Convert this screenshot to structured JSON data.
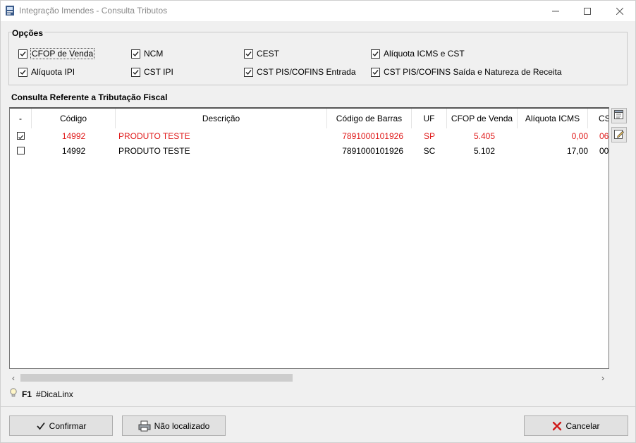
{
  "window": {
    "title": "Integração Imendes - Consulta Tributos"
  },
  "options": {
    "title": "Opções",
    "checkboxes": [
      {
        "label": "CFOP de Venda",
        "checked": true
      },
      {
        "label": "NCM",
        "checked": true
      },
      {
        "label": "CEST",
        "checked": true
      },
      {
        "label": "Alíquota ICMS e CST",
        "checked": true
      },
      {
        "label": "Alíquota IPI",
        "checked": true
      },
      {
        "label": "CST IPI",
        "checked": true
      },
      {
        "label": "CST PIS/COFINS Entrada",
        "checked": true
      },
      {
        "label": "CST PIS/COFINS Saída e Natureza de Receita",
        "checked": true
      }
    ]
  },
  "grid": {
    "title": "Consulta Referente a Tributação Fiscal",
    "columns": [
      "-",
      "Código",
      "Descrição",
      "Código de Barras",
      "UF",
      "CFOP de Venda",
      "Alíquota ICMS",
      "CS"
    ],
    "rows": [
      {
        "checked": true,
        "highlight": true,
        "codigo": "14992",
        "descricao": "PRODUTO TESTE",
        "barras": "7891000101926",
        "uf": "SP",
        "cfop": "5.405",
        "aliquota": "0,00",
        "cs": "06"
      },
      {
        "checked": false,
        "highlight": false,
        "codigo": "14992",
        "descricao": "PRODUTO TESTE",
        "barras": "7891000101926",
        "uf": "SC",
        "cfop": "5.102",
        "aliquota": "17,00",
        "cs": "00"
      }
    ],
    "highlight_color": "#e01b1b"
  },
  "hint": {
    "key": "F1",
    "text": "#DicaLinx"
  },
  "buttons": {
    "confirm": "Confirmar",
    "not_found": "Não localizado",
    "cancel": "Cancelar"
  }
}
